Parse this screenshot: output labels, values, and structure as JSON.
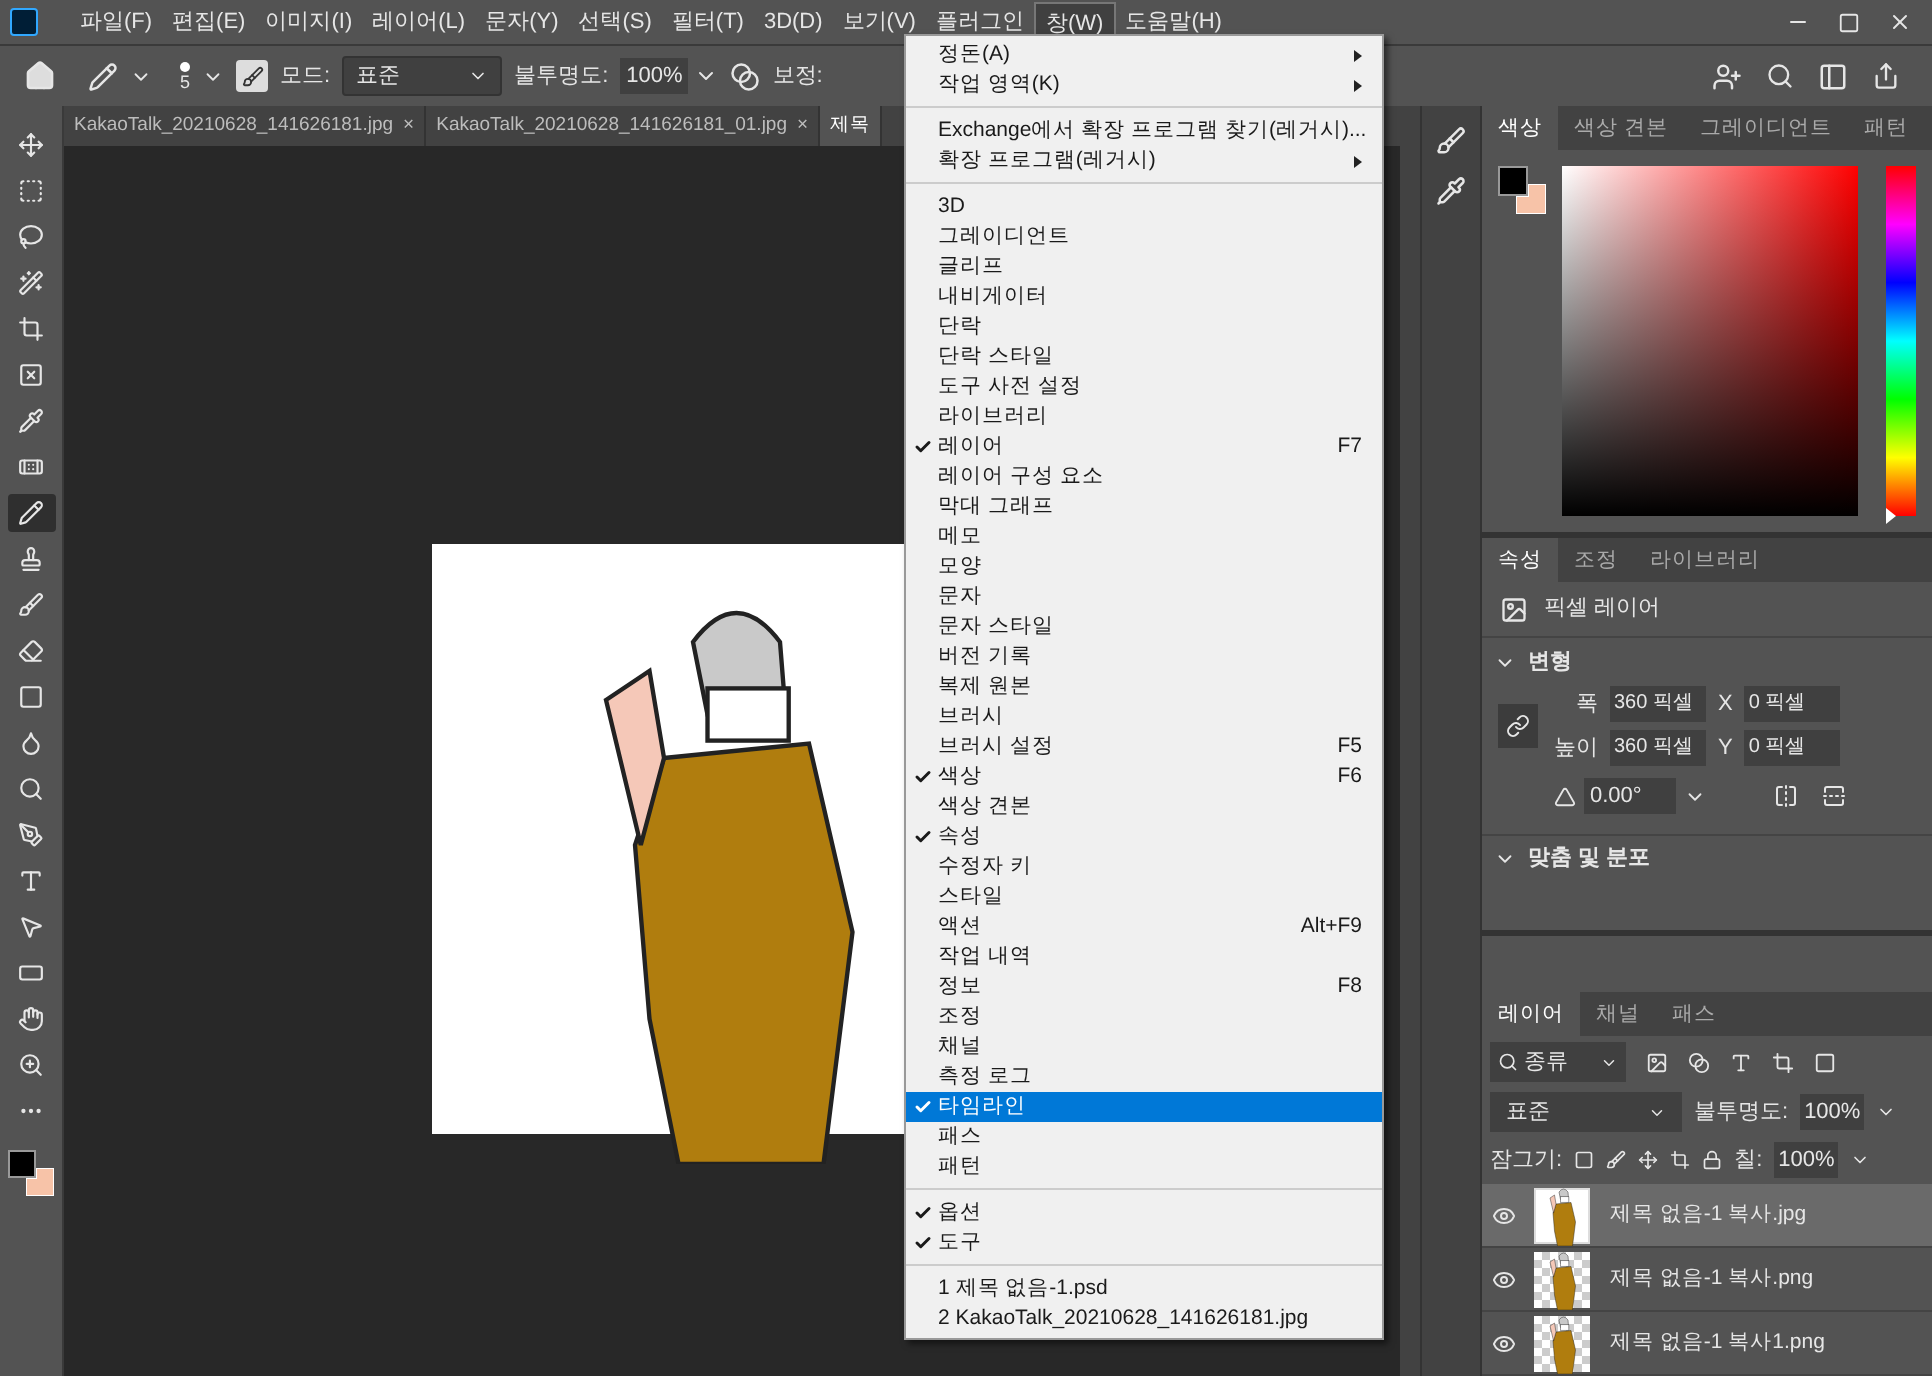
{
  "menubar": {
    "items": [
      {
        "label": "파일(F)",
        "selected": false
      },
      {
        "label": "편집(E)",
        "selected": false
      },
      {
        "label": "이미지(I)",
        "selected": false
      },
      {
        "label": "레이어(L)",
        "selected": false
      },
      {
        "label": "문자(Y)",
        "selected": false
      },
      {
        "label": "선택(S)",
        "selected": false
      },
      {
        "label": "필터(T)",
        "selected": false
      },
      {
        "label": "3D(D)",
        "selected": false
      },
      {
        "label": "보기(V)",
        "selected": false
      },
      {
        "label": "플러그인",
        "selected": false
      },
      {
        "label": "창(W)",
        "selected": true
      },
      {
        "label": "도움말(H)",
        "selected": false
      }
    ]
  },
  "options_bar": {
    "brush_size": "5",
    "mode_label": "모드:",
    "mode": "표준",
    "opacity_label": "불투명도:",
    "opacity": "100%",
    "smoothing_label": "보정:"
  },
  "document_tabs": [
    {
      "label": "KakaoTalk_20210628_141626181.jpg",
      "close": "×",
      "selected": false
    },
    {
      "label": "KakaoTalk_20210628_141626181_01.jpg",
      "close": "×",
      "selected": false
    },
    {
      "label": "제목",
      "selected": true
    }
  ],
  "tools": [
    {
      "kind": "move",
      "selected": false
    },
    {
      "kind": "marquee",
      "selected": false
    },
    {
      "kind": "lasso",
      "selected": false
    },
    {
      "kind": "wand",
      "selected": false
    },
    {
      "kind": "crop",
      "selected": false
    },
    {
      "kind": "frame",
      "selected": false
    },
    {
      "kind": "eyedropper",
      "selected": false
    },
    {
      "kind": "heal",
      "selected": false
    },
    {
      "kind": "pencil",
      "selected": true
    },
    {
      "kind": "stamp",
      "selected": false
    },
    {
      "kind": "brush",
      "selected": false
    },
    {
      "kind": "eraser",
      "selected": false
    },
    {
      "kind": "gradient",
      "selected": false
    },
    {
      "kind": "drop",
      "selected": false
    },
    {
      "kind": "dodge",
      "selected": false
    },
    {
      "kind": "pen",
      "selected": false
    },
    {
      "kind": "type",
      "selected": false
    },
    {
      "kind": "pointer",
      "selected": false
    },
    {
      "kind": "rect",
      "selected": false
    },
    {
      "kind": "hand",
      "selected": false
    },
    {
      "kind": "zoom",
      "selected": false
    },
    {
      "kind": "more",
      "selected": false
    }
  ],
  "swatches": {
    "foreground": {
      "color": "#000000"
    },
    "background": {
      "color": "#f7c3a8"
    }
  },
  "window_menu": {
    "groups": [
      [
        {
          "label": "정돈(A)",
          "checked": false,
          "submenu": true,
          "selected": false
        },
        {
          "label": "작업 영역(K)",
          "checked": false,
          "submenu": true,
          "selected": false
        }
      ],
      [
        {
          "label": "Exchange에서 확장 프로그램 찾기(레거시)...",
          "checked": false,
          "submenu": false,
          "selected": false
        },
        {
          "label": "확장 프로그램(레거시)",
          "checked": false,
          "submenu": true,
          "selected": false
        }
      ],
      [
        {
          "label": "3D",
          "checked": false,
          "submenu": false,
          "selected": false
        },
        {
          "label": "그레이디언트",
          "checked": false,
          "submenu": false,
          "selected": false
        },
        {
          "label": "글리프",
          "checked": false,
          "submenu": false,
          "selected": false
        },
        {
          "label": "내비게이터",
          "checked": false,
          "submenu": false,
          "selected": false
        },
        {
          "label": "단락",
          "checked": false,
          "submenu": false,
          "selected": false
        },
        {
          "label": "단락 스타일",
          "checked": false,
          "submenu": false,
          "selected": false
        },
        {
          "label": "도구 사전 설정",
          "checked": false,
          "submenu": false,
          "selected": false
        },
        {
          "label": "라이브러리",
          "checked": false,
          "submenu": false,
          "selected": false
        },
        {
          "label": "레이어",
          "checked": true,
          "shortcut": "F7",
          "submenu": false,
          "selected": false
        },
        {
          "label": "레이어 구성 요소",
          "checked": false,
          "submenu": false,
          "selected": false
        },
        {
          "label": "막대 그래프",
          "checked": false,
          "submenu": false,
          "selected": false
        },
        {
          "label": "메모",
          "checked": false,
          "submenu": false,
          "selected": false
        },
        {
          "label": "모양",
          "checked": false,
          "submenu": false,
          "selected": false
        },
        {
          "label": "문자",
          "checked": false,
          "submenu": false,
          "selected": false
        },
        {
          "label": "문자 스타일",
          "checked": false,
          "submenu": false,
          "selected": false
        },
        {
          "label": "버전 기록",
          "checked": false,
          "submenu": false,
          "selected": false
        },
        {
          "label": "복제 원본",
          "checked": false,
          "submenu": false,
          "selected": false
        },
        {
          "label": "브러시",
          "checked": false,
          "submenu": false,
          "selected": false
        },
        {
          "label": "브러시 설정",
          "checked": false,
          "shortcut": "F5",
          "submenu": false,
          "selected": false
        },
        {
          "label": "색상",
          "checked": true,
          "shortcut": "F6",
          "submenu": false,
          "selected": false
        },
        {
          "label": "색상 견본",
          "checked": false,
          "submenu": false,
          "selected": false
        },
        {
          "label": "속성",
          "checked": true,
          "submenu": false,
          "selected": false
        },
        {
          "label": "수정자 키",
          "checked": false,
          "submenu": false,
          "selected": false
        },
        {
          "label": "스타일",
          "checked": false,
          "submenu": false,
          "selected": false
        },
        {
          "label": "액션",
          "checked": false,
          "shortcut": "Alt+F9",
          "submenu": false,
          "selected": false
        },
        {
          "label": "작업 내역",
          "checked": false,
          "submenu": false,
          "selected": false
        },
        {
          "label": "정보",
          "checked": false,
          "shortcut": "F8",
          "submenu": false,
          "selected": false
        },
        {
          "label": "조정",
          "checked": false,
          "submenu": false,
          "selected": false
        },
        {
          "label": "채널",
          "checked": false,
          "submenu": false,
          "selected": false
        },
        {
          "label": "측정 로그",
          "checked": false,
          "submenu": false,
          "selected": false
        },
        {
          "label": "타임라인",
          "checked": true,
          "submenu": false,
          "selected": true
        },
        {
          "label": "패스",
          "checked": false,
          "submenu": false,
          "selected": false
        },
        {
          "label": "패턴",
          "checked": false,
          "submenu": false,
          "selected": false
        }
      ],
      [
        {
          "label": "옵션",
          "checked": true,
          "submenu": false,
          "selected": false
        },
        {
          "label": "도구",
          "checked": true,
          "submenu": false,
          "selected": false
        }
      ],
      [
        {
          "label": "1 제목 없음-1.psd",
          "checked": false,
          "submenu": false,
          "selected": false
        },
        {
          "label": "2 KakaoTalk_20210628_141626181.jpg",
          "checked": false,
          "submenu": false,
          "selected": false
        }
      ]
    ]
  },
  "color_panel": {
    "hue": {
      "level": 0
    },
    "tabs": [
      {
        "label": "색상",
        "selected": true
      },
      {
        "label": "색상 견본",
        "selected": false
      },
      {
        "label": "그레이디언트",
        "selected": false
      },
      {
        "label": "패턴",
        "selected": false
      }
    ]
  },
  "properties_panel": {
    "tabs": [
      {
        "label": "속성",
        "selected": true
      },
      {
        "label": "조정",
        "selected": false
      },
      {
        "label": "라이브러리",
        "selected": false
      }
    ],
    "layer_type": "픽셀 레이어",
    "transform_title": "변형",
    "width_label": "폭",
    "width": "360 픽셀",
    "x_label": "X",
    "x": "0 픽셀",
    "height_label": "높이",
    "height": "360 픽셀",
    "y_label": "Y",
    "y": "0 픽셀",
    "angle": "0.00°",
    "align_title": "맞춤 및 분포"
  },
  "layers_panel": {
    "tabs": [
      {
        "label": "레이어",
        "selected": true
      },
      {
        "label": "채널",
        "selected": false
      },
      {
        "label": "패스",
        "selected": false
      }
    ],
    "filter": "종류",
    "blend_mode": "표준",
    "opacity_label": "불투명도:",
    "opacity": "100%",
    "lock_label": "잠그기:",
    "fill_label": "칠:",
    "fill": "100%",
    "layers": [
      {
        "name": "제목 없음-1 복사.jpg",
        "visible": true,
        "selected": true,
        "transparent": false
      },
      {
        "name": "제목 없음-1 복사.png",
        "visible": true,
        "selected": false,
        "transparent": true
      },
      {
        "name": "제목 없음-1 복사1.png",
        "visible": true,
        "selected": false,
        "transparent": true
      }
    ]
  }
}
